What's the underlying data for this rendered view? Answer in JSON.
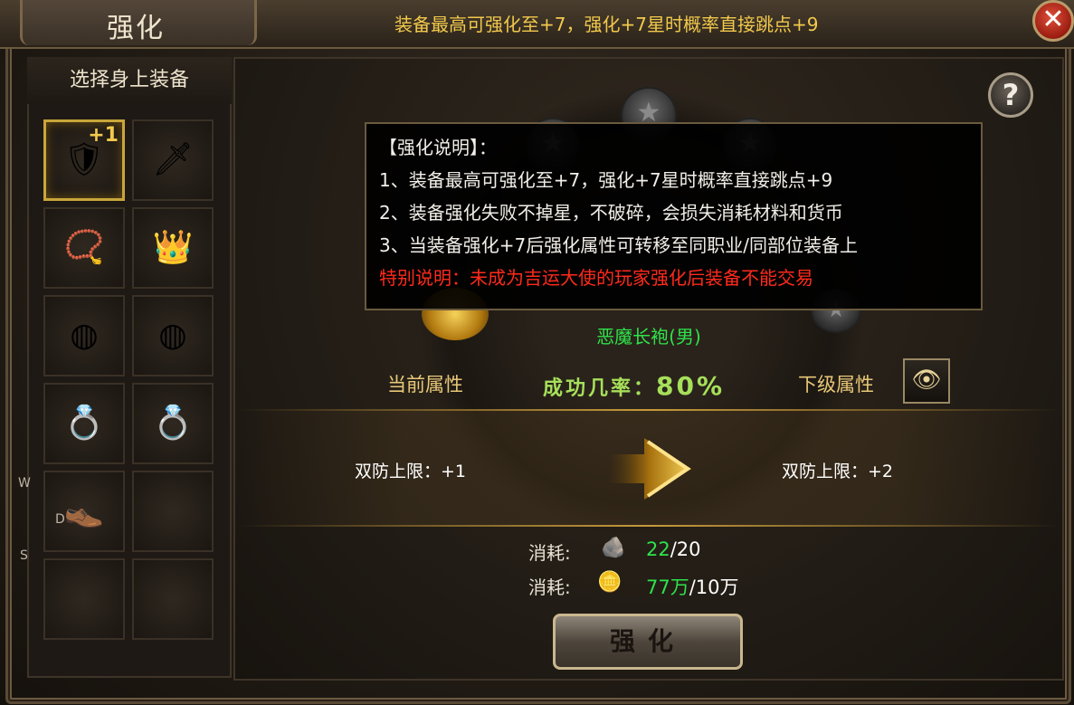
{
  "title": "强化",
  "header_note": "装备最高可强化至+7，强化+7星时概率直接跳点+9",
  "close_label": "✕",
  "help_label": "?",
  "left_panel": {
    "heading": "选择身上装备",
    "slots": [
      {
        "icon": "armor-icon",
        "glyph": "🛡",
        "badge": "+1",
        "selected": true
      },
      {
        "icon": "sword-icon",
        "glyph": "🗡",
        "badge": "",
        "selected": false
      },
      {
        "icon": "necklace-icon",
        "glyph": "📿",
        "badge": "",
        "selected": false
      },
      {
        "icon": "helmet-icon",
        "glyph": "👑",
        "badge": "",
        "selected": false
      },
      {
        "icon": "bracelet-icon",
        "glyph": "◍",
        "badge": "",
        "selected": false
      },
      {
        "icon": "bracelet-icon",
        "glyph": "◍",
        "badge": "",
        "selected": false
      },
      {
        "icon": "ring-icon",
        "glyph": "💍",
        "badge": "",
        "selected": false
      },
      {
        "icon": "ring-icon",
        "glyph": "💍",
        "badge": "",
        "selected": false
      },
      {
        "icon": "boots-icon",
        "glyph": "👞",
        "badge": "",
        "selected": false
      },
      {
        "icon": "empty-slot",
        "glyph": "",
        "badge": "",
        "selected": false
      },
      {
        "icon": "empty-slot",
        "glyph": "",
        "badge": "",
        "selected": false
      },
      {
        "icon": "empty-slot",
        "glyph": "",
        "badge": "",
        "selected": false
      }
    ],
    "side_letters": [
      "W",
      "D",
      "S"
    ]
  },
  "tooltip": {
    "lines": [
      "【强化说明】：",
      "1、装备最高可强化至+7，强化+7星时概率直接跳点+9",
      "2、装备强化失败不掉星，不破碎，会损失消耗材料和货币",
      "3、当装备强化+7后强化属性可转移至同职业/同部位装备上"
    ],
    "warning": "特别说明：未成为吉运大使的玩家强化后装备不能交易"
  },
  "item_name": "恶魔长袍(男)",
  "current_label": "当前属性",
  "next_label": "下级属性",
  "success_rate_label": "成功几率：",
  "success_rate_value": "80%",
  "eye_icon": "eye-icon",
  "current_stat": "双防上限：+1",
  "next_stat": "双防上限：+2",
  "costs": [
    {
      "label": "消耗:",
      "icon": "ore-icon",
      "glyph": "🪨",
      "have": "22",
      "need": "/20"
    },
    {
      "label": "消耗:",
      "icon": "gold-coins-icon",
      "glyph": "🪙",
      "have": "77万",
      "need": "/10万"
    }
  ],
  "enhance_button": "强化",
  "colors": {
    "gold": "#f2c94c",
    "green": "#2fe24a",
    "warning_red": "#ff2a1c",
    "label_gold": "#e8c878"
  }
}
